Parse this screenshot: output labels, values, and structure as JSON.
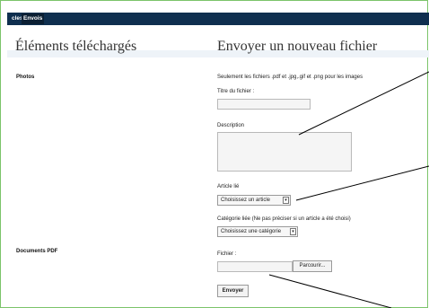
{
  "tabs": [
    {
      "label": "cles"
    },
    {
      "label": "Envois"
    }
  ],
  "left_panel": {
    "title": "Éléments téléchargés",
    "sections": {
      "photos": "Photos",
      "pdf": "Documents PDF"
    }
  },
  "form": {
    "title": "Envoyer un nouveau fichier",
    "notice": "Seulement les fichiers .pdf et .jpg,.gif et .png pour les images",
    "file_title_label": "Titre du fichier :",
    "file_title_value": "",
    "description_label": "Description",
    "description_value": "",
    "article_label": "Article lié",
    "article_selected": "Choisissez un article",
    "category_label": "Catégorie liée (Ne pas préciser si un article a été choisi)",
    "category_selected": "Choisissez une catégorie",
    "file_label": "Fichier :",
    "browse_label": "Parcourir...",
    "submit_label": "Envoyer"
  },
  "icons": {
    "select_arrow": "chevron-down-icon"
  },
  "colors": {
    "topbar": "#0f2f4f",
    "frame_border": "#7cc46a",
    "band": "#eef3f8"
  }
}
